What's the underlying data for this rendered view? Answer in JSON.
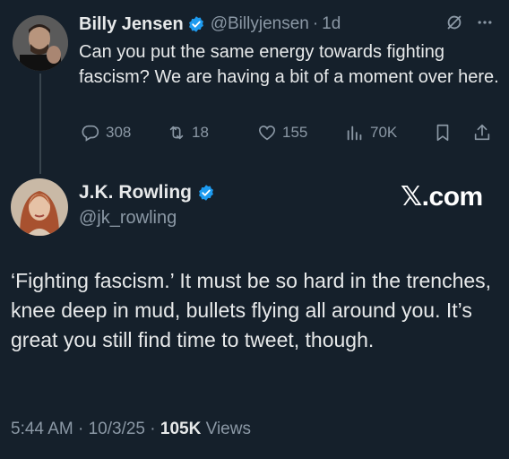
{
  "reply": {
    "name": "Billy Jensen",
    "handle": "@Billyjensen",
    "separator": "·",
    "time": "1d",
    "text": "Can you put the same energy towards fighting fascism? We are having a bit of a moment over here.",
    "stats": {
      "replies": "308",
      "retweets": "18",
      "likes": "155",
      "views": "70K"
    }
  },
  "main": {
    "name": "J.K. Rowling",
    "handle": "@jk_rowling",
    "text": "‘Fighting fascism.’ It must be so hard in the trenches, knee deep in mud, bullets flying all around you. It’s great you still find time to tweet, though.",
    "time": "5:44 AM",
    "sep": "·",
    "date": "10/3/25",
    "views_count": "105K",
    "views_label": "Views"
  },
  "watermark": {
    "x": "𝕏",
    "suffix": ".com"
  },
  "colors": {
    "background": "#15202b",
    "verified": "#1d9bf0",
    "muted": "#8b98a5",
    "text": "#e7e9ea"
  }
}
